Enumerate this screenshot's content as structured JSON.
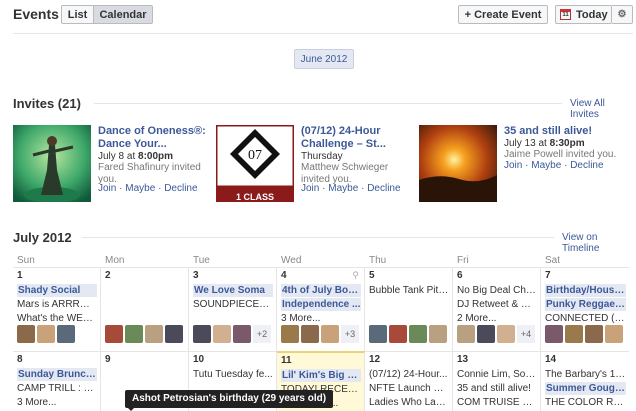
{
  "header": {
    "title": "Events",
    "view_list": "List",
    "view_calendar": "Calendar",
    "create_event": "+ Create Event",
    "today": "Today",
    "today_icon_day": "11",
    "gear": "⚙"
  },
  "month_pill": "June 2012",
  "invites": {
    "title": "Invites (21)",
    "view_all": "View All Invites",
    "items": [
      {
        "title": "Dance of Oneness®: Dance Your...",
        "date_prefix": "July 8 at ",
        "date_bold": "8:00pm",
        "who": "Fared Shafinury invited you.",
        "join": "Join",
        "maybe": "Maybe",
        "decline": "Decline"
      },
      {
        "title": "(07/12) 24-Hour Challenge – St...",
        "date_prefix": "Thursday",
        "date_bold": "",
        "who": "Matthew Schwieger invited you.",
        "join": "Join",
        "maybe": "Maybe",
        "decline": "Decline",
        "badge": "07",
        "badge_text": "1 CLASS"
      },
      {
        "title": "35 and still alive!",
        "date_prefix": "July 13 at ",
        "date_bold": "8:30pm",
        "who": "Jaime Powell invited you.",
        "join": "Join",
        "maybe": "Maybe",
        "decline": "Decline"
      }
    ],
    "sep": "·"
  },
  "calendar": {
    "title": "July 2012",
    "view_link": "View on Timeline",
    "days": [
      "Sun",
      "Mon",
      "Tue",
      "Wed",
      "Thu",
      "Fri",
      "Sat"
    ],
    "week1": [
      {
        "num": "1",
        "events": [
          {
            "t": "Shady Social",
            "hl": true
          },
          {
            "t": "Mars is ARRRRRR..."
          },
          {
            "t": "What's the WERD..."
          }
        ],
        "thumbs": 3,
        "plus": ""
      },
      {
        "num": "2",
        "events": [],
        "thumbs": 4,
        "plus": ""
      },
      {
        "num": "3",
        "events": [
          {
            "t": "We Love Soma",
            "hl": true
          },
          {
            "t": "SOUNDPIECES T..."
          }
        ],
        "thumbs": 3,
        "plus": "+2"
      },
      {
        "num": "4",
        "events": [
          {
            "t": "4th of July Booz...",
            "hl": true
          },
          {
            "t": "Independence ...",
            "hl": true
          },
          {
            "t": "3 More...",
            "more": true
          }
        ],
        "thumbs": 3,
        "plus": "+3"
      },
      {
        "num": "5",
        "events": [
          {
            "t": "Bubble Tank Pitc..."
          }
        ],
        "thumbs": 4,
        "plus": ""
      },
      {
        "num": "6",
        "events": [
          {
            "t": "No Big Deal Chill..."
          },
          {
            "t": "DJ Retweet & Hy..."
          },
          {
            "t": "2 More...",
            "more": true
          }
        ],
        "thumbs": 3,
        "plus": "+4"
      },
      {
        "num": "7",
        "events": [
          {
            "t": "Birthday/House...",
            "hl": true
          },
          {
            "t": "Punky Reggae P...",
            "hl": true
          },
          {
            "t": "CONNECTED (SUN..."
          }
        ],
        "thumbs": 4,
        "plus": ""
      }
    ],
    "week2": [
      {
        "num": "8",
        "events": [
          {
            "t": "Sunday Brunch ...",
            "hl": true
          },
          {
            "t": "CAMP TRILL : BE..."
          },
          {
            "t": "3 More...",
            "more": true
          }
        ]
      },
      {
        "num": "9",
        "events": []
      },
      {
        "num": "10",
        "events": [
          {
            "t": "Tutu Tuesday fe..."
          }
        ]
      },
      {
        "num": "11",
        "events": [
          {
            "t": "Lil' Kim's Big Birt...",
            "hl": true
          },
          {
            "t": "TODAY! RECESS ..."
          },
          {
            "t": "10 – Startu..."
          }
        ]
      },
      {
        "num": "12",
        "events": [
          {
            "t": "(07/12) 24-Hour..."
          },
          {
            "t": "NFTE Launch De..."
          },
          {
            "t": "Ladies Who Laun..."
          }
        ]
      },
      {
        "num": "13",
        "events": [
          {
            "t": "Connie Lim, Soni..."
          },
          {
            "t": "35 and still alive!"
          },
          {
            "t": "COM TRUISE + B..."
          }
        ]
      },
      {
        "num": "14",
        "events": [
          {
            "t": "The Barbary's 1s..."
          },
          {
            "t": "Summer Gough...",
            "hl": true
          },
          {
            "t": "THE COLOR RUN..."
          }
        ]
      }
    ]
  },
  "tooltip": "Ashot Petrosian's birthday (29 years old)",
  "colors": {
    "link": "#3b5998",
    "today_bg": "#fff9d7",
    "highlight_bg": "#e4e8f2"
  }
}
